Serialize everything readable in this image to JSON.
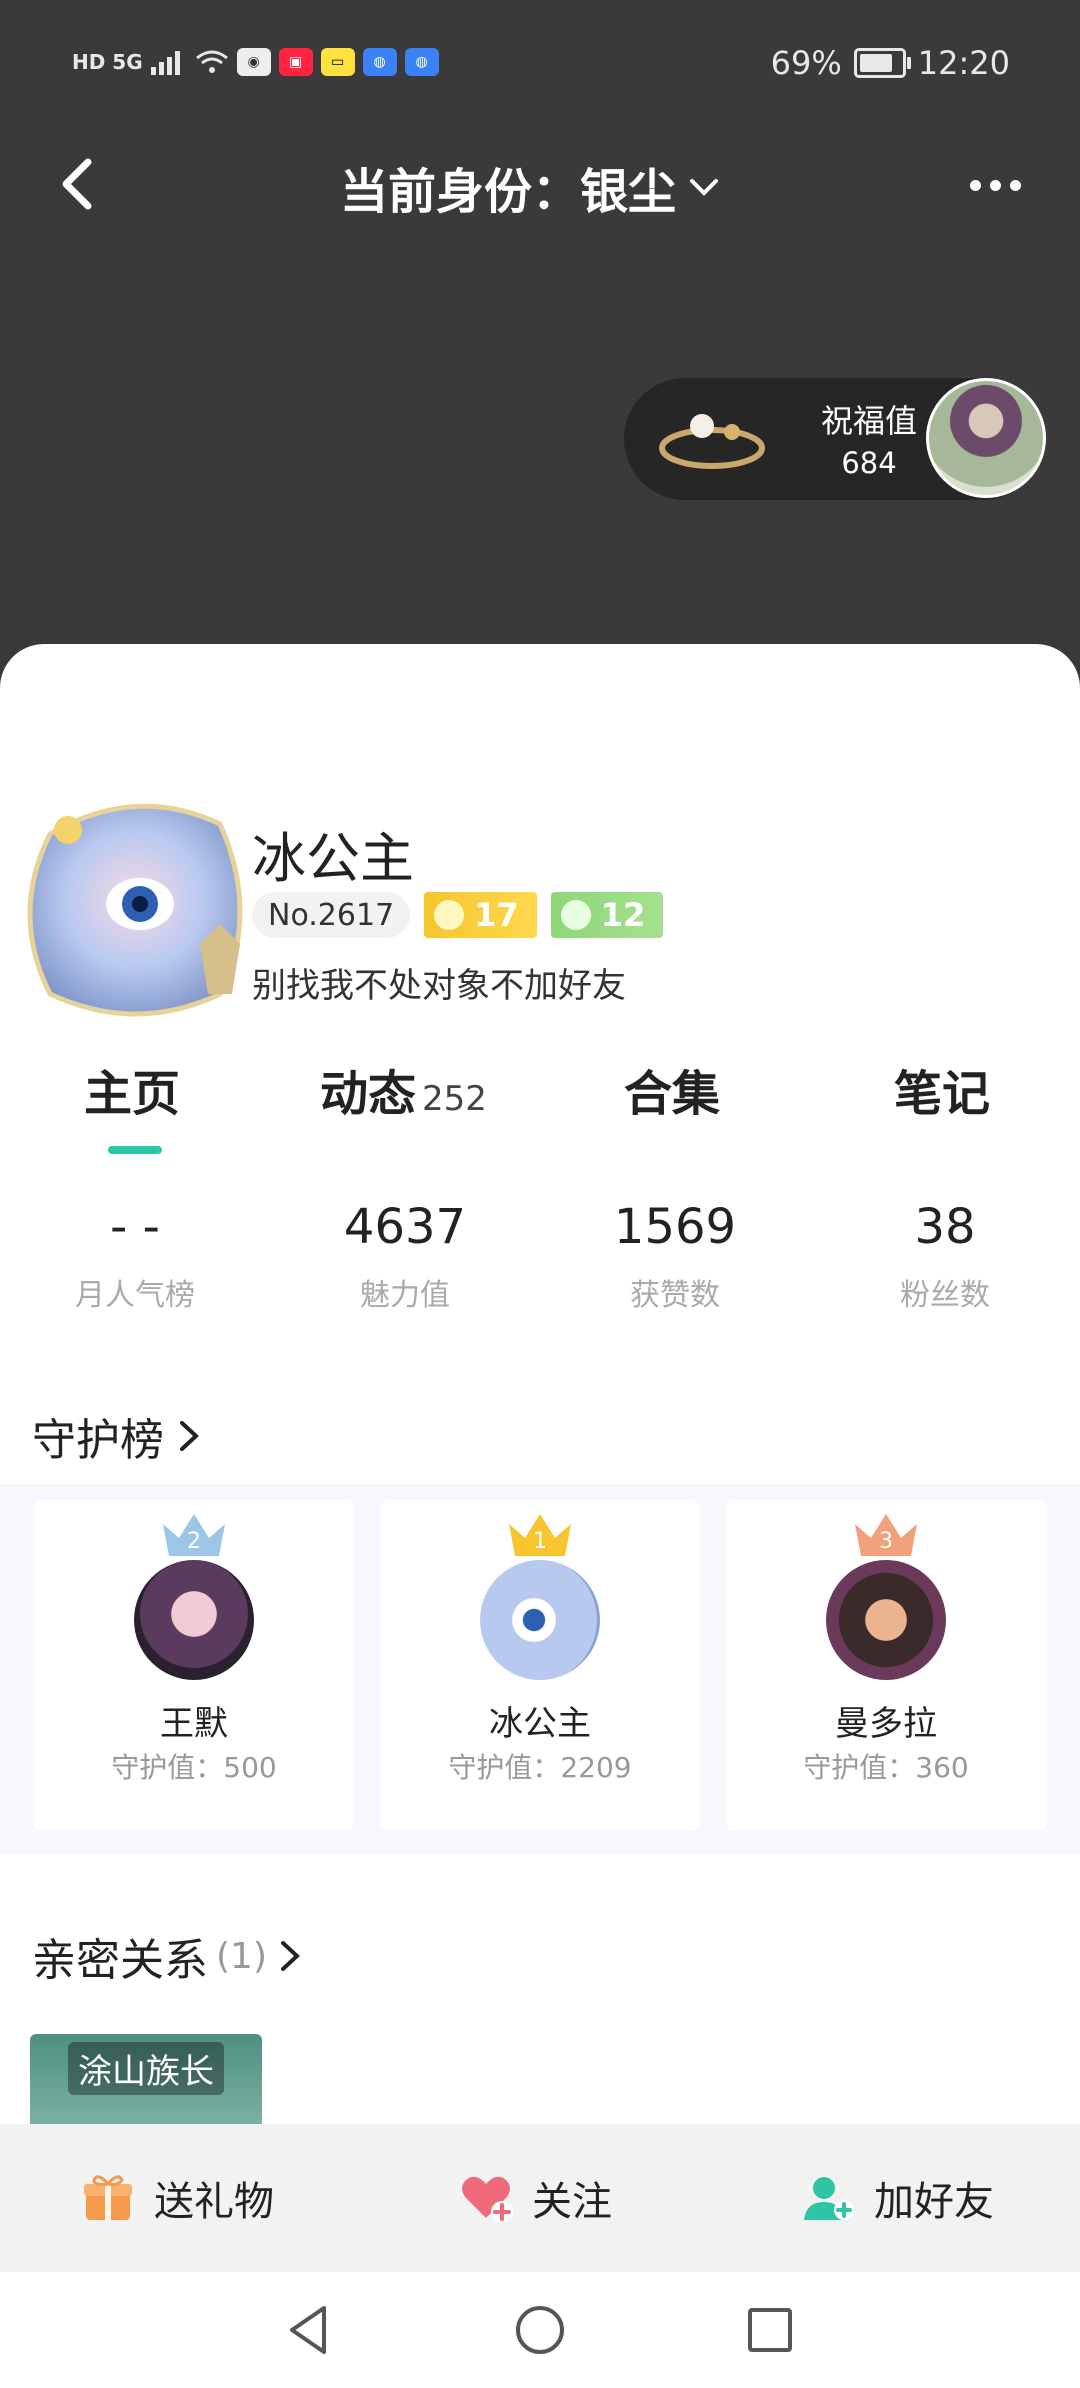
{
  "status_bar": {
    "left_text": "HD 5G",
    "app_icons": [
      "game-app-icon",
      "xiaohongshu-icon",
      "bilibili-icon",
      "browser-icon",
      "browser-icon"
    ],
    "battery": "69%",
    "battery_level": 0.69,
    "time": "12:20"
  },
  "nav": {
    "identity_title": "当前身份：银尘"
  },
  "blessing": {
    "label": "祝福值",
    "value": "684"
  },
  "profile": {
    "name": "冰公主",
    "number": "No.2617",
    "level_sun": "17",
    "level_gem": "12",
    "bio": "别找我不处对象不加好友"
  },
  "tabs": [
    {
      "label": "主页",
      "count": ""
    },
    {
      "label": "动态",
      "count": "252"
    },
    {
      "label": "合集",
      "count": ""
    },
    {
      "label": "笔记",
      "count": ""
    }
  ],
  "stats": [
    {
      "value": "- -",
      "label": "月人气榜"
    },
    {
      "value": "4637",
      "label": "魅力值"
    },
    {
      "value": "1569",
      "label": "获赞数"
    },
    {
      "value": "38",
      "label": "粉丝数"
    }
  ],
  "guard": {
    "title": "守护榜",
    "cards": [
      {
        "rank": "2",
        "name": "王默",
        "value": "守护值：500"
      },
      {
        "rank": "1",
        "name": "冰公主",
        "value": "守护值：2209"
      },
      {
        "rank": "3",
        "name": "曼多拉",
        "value": "守护值：360"
      }
    ]
  },
  "intimate": {
    "title": "亲密关系",
    "count": "(1)",
    "card_tag": "涂山族长"
  },
  "actions": {
    "gift": "送礼物",
    "follow": "关注",
    "add_friend": "加好友"
  },
  "colors": {
    "accent": "#2ec4a6",
    "top_bg": "#3a3a3a",
    "rank1": "#f7c52d",
    "rank2": "#9cc6e8",
    "rank3": "#f2a07a"
  }
}
